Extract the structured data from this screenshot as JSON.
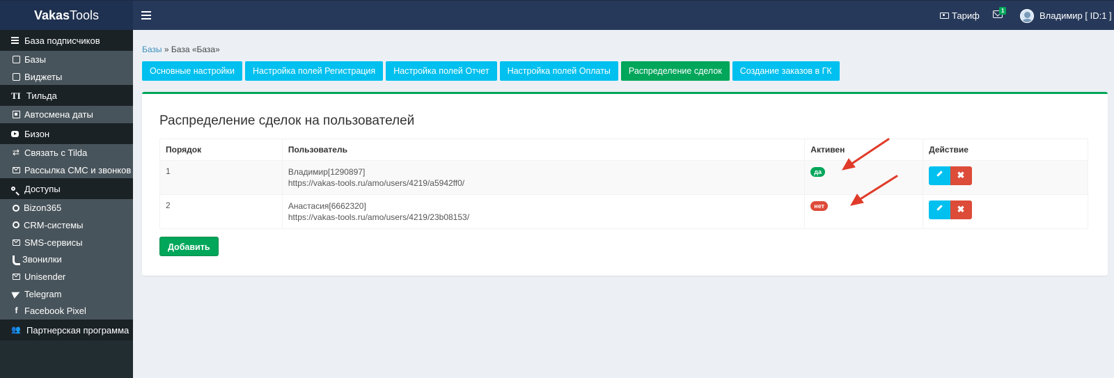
{
  "header": {
    "logo_bold": "Vakas",
    "logo_rest": "Tools",
    "tarif_label": "Тариф",
    "mail_badge": "1",
    "user_name": "Владимир [ ID:1 ]"
  },
  "sidebar": {
    "items": [
      {
        "type": "header",
        "label": "База подписчиков",
        "icon": "list-icon"
      },
      {
        "type": "sub",
        "label": "Базы",
        "icon": "database-icon"
      },
      {
        "type": "sub",
        "label": "Виджеты",
        "icon": "widget-icon"
      },
      {
        "type": "header",
        "label": "Тильда",
        "icon": "text-icon"
      },
      {
        "type": "sub",
        "label": "Автосмена даты",
        "icon": "calendar-icon"
      },
      {
        "type": "header",
        "label": "Бизон",
        "icon": "youtube-icon"
      },
      {
        "type": "sub",
        "label": "Связать с Tilda",
        "icon": "arrows-icon"
      },
      {
        "type": "sub",
        "label": "Рассылка СМС и звонков",
        "icon": "envelope-icon"
      },
      {
        "type": "header",
        "label": "Доступы",
        "icon": "key-icon"
      },
      {
        "type": "sub",
        "label": "Bizon365",
        "icon": "circle-icon"
      },
      {
        "type": "sub",
        "label": "CRM-системы",
        "icon": "circle-icon"
      },
      {
        "type": "sub",
        "label": "SMS-сервисы",
        "icon": "envelope-icon"
      },
      {
        "type": "sub",
        "label": "Звонилки",
        "icon": "phone-icon"
      },
      {
        "type": "sub",
        "label": "Unisender",
        "icon": "envelope-icon"
      },
      {
        "type": "sub",
        "label": "Telegram",
        "icon": "paper-plane-icon"
      },
      {
        "type": "sub",
        "label": "Facebook Pixel",
        "icon": "facebook-icon"
      },
      {
        "type": "header",
        "label": "Партнерская программа",
        "icon": "users-icon"
      }
    ]
  },
  "breadcrumb": {
    "link": "Базы",
    "separator": "»",
    "current": "База «База»"
  },
  "tabs": [
    {
      "label": "Основные настройки",
      "active": false
    },
    {
      "label": "Настройка полей Регистрация",
      "active": false
    },
    {
      "label": "Настройка полей Отчет",
      "active": false
    },
    {
      "label": "Настройка полей Оплаты",
      "active": false
    },
    {
      "label": "Распределение сделок",
      "active": true
    },
    {
      "label": "Создание заказов в ГК",
      "active": false
    }
  ],
  "panel": {
    "title": "Распределение сделок на пользователей",
    "columns": [
      "Порядок",
      "Пользователь",
      "Активен",
      "Действие"
    ],
    "rows": [
      {
        "order": "1",
        "user": "Владимир[1290897]",
        "url": "https://vakas-tools.ru/amo/users/4219/a5942ff0/",
        "active": "да",
        "active_color": "#00a65a"
      },
      {
        "order": "2",
        "user": "Анастасия[6662320]",
        "url": "https://vakas-tools.ru/amo/users/4219/23b08153/",
        "active": "нет",
        "active_color": "#dd4b39"
      }
    ],
    "add_label": "Добавить"
  },
  "colors": {
    "accent_green": "#00a65a",
    "accent_cyan": "#00c0ef",
    "danger": "#dd4b39",
    "topbar": "#27395a",
    "sidebar": "#222d32"
  }
}
